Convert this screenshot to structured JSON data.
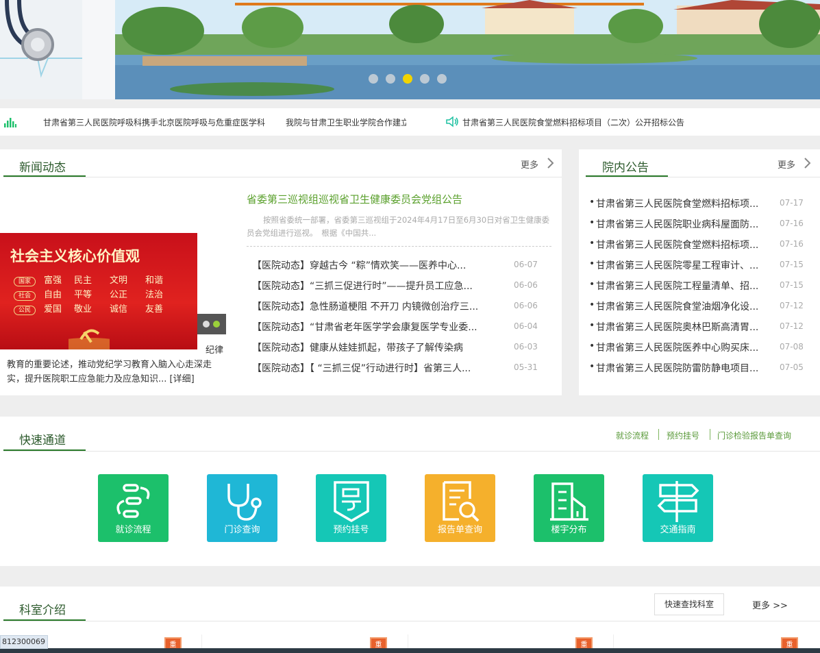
{
  "ticker": {
    "items": [
      "甘肃省第三人民医院呼吸科携手北京医院呼吸与危重症医学科",
      "我院与甘肃卫生职业学院合作建立",
      "甘肃省第三人民医院食堂燃料招标项目（二次）公开招标公告"
    ]
  },
  "news": {
    "title": "新闻动态",
    "more": "更多",
    "headline": "省委第三巡视组巡视省卫生健康委员会党组公告",
    "summary": "按照省委统一部署，省委第三巡视组于2024年4月17日至6月30日对省卫生健康委员会党组进行巡视。　根据《中国共...",
    "side_text": "教育的重要论述，推动党纪学习教育入脑入心走深走实，提升医院职工应急能力及应急知识... [详细]",
    "side_text_top": "纪律",
    "poster": {
      "title": "社会主义核心价值观",
      "rows": [
        {
          "tag": "国家",
          "words": [
            "富强",
            "民主",
            "文明",
            "和谐"
          ]
        },
        {
          "tag": "社会",
          "words": [
            "自由",
            "平等",
            "公正",
            "法治"
          ]
        },
        {
          "tag": "公民",
          "words": [
            "爱国",
            "敬业",
            "诚信",
            "友善"
          ]
        }
      ]
    },
    "items": [
      {
        "title": "【医院动态】穿越古今 “粽”情欢笑——医养中心...",
        "date": "06-07"
      },
      {
        "title": "【医院动态】“三抓三促进行时”——提升员工应急...",
        "date": "06-06"
      },
      {
        "title": "【医院动态】急性肠道梗阻 不开刀 内镜微创治疗三...",
        "date": "06-06"
      },
      {
        "title": "【医院动态】“甘肃省老年医学学会康复医学专业委...",
        "date": "06-04"
      },
      {
        "title": "【医院动态】健康从娃娃抓起，带孩子了解传染病",
        "date": "06-03"
      },
      {
        "title": "【医院动态】【 “三抓三促”行动进行时】省第三人...",
        "date": "05-31"
      }
    ]
  },
  "notice": {
    "title": "院内公告",
    "more": "更多",
    "bullet": "•",
    "items": [
      {
        "title": "甘肃省第三人民医院食堂燃料招标项...",
        "date": "07-17"
      },
      {
        "title": "甘肃省第三人民医院职业病科屋面防...",
        "date": "07-16"
      },
      {
        "title": "甘肃省第三人民医院食堂燃料招标项...",
        "date": "07-16"
      },
      {
        "title": "甘肃省第三人民医院零星工程审计、...",
        "date": "07-15"
      },
      {
        "title": "甘肃省第三人民医院工程量清单、招...",
        "date": "07-15"
      },
      {
        "title": "甘肃省第三人民医院食堂油烟净化设...",
        "date": "07-12"
      },
      {
        "title": "甘肃省第三人民医院奥林巴斯高清胃...",
        "date": "07-12"
      },
      {
        "title": "甘肃省第三人民医院医养中心购买床...",
        "date": "07-08"
      },
      {
        "title": "甘肃省第三人民医院防雷防静电项目...",
        "date": "07-05"
      }
    ]
  },
  "quick": {
    "title": "快速通道",
    "links": [
      "就诊流程",
      "预约挂号",
      "门诊检验报告单查询"
    ],
    "tiles": [
      {
        "label": "就诊流程",
        "color": "#1cc06b",
        "icon": "flow-icon"
      },
      {
        "label": "门诊查询",
        "color": "#1fb7d6",
        "icon": "stethoscope-icon"
      },
      {
        "label": "预约挂号",
        "color": "#15c7b6",
        "icon": "ticket-icon"
      },
      {
        "label": "报告单查询",
        "color": "#f5b02c",
        "icon": "report-search-icon"
      },
      {
        "label": "楼宇分布",
        "color": "#1cc06b",
        "icon": "building-icon"
      },
      {
        "label": "交通指南",
        "color": "#15c7b6",
        "icon": "signpost-icon"
      }
    ]
  },
  "dept": {
    "title": "科室介绍",
    "find_button": "快速查找科室",
    "more": "更多 >>",
    "badge": "重"
  },
  "status": {
    "phone_fragment": "812300069"
  },
  "colors": {
    "brand_green": "#2a7a2a",
    "headline_green": "#5aa02c"
  }
}
